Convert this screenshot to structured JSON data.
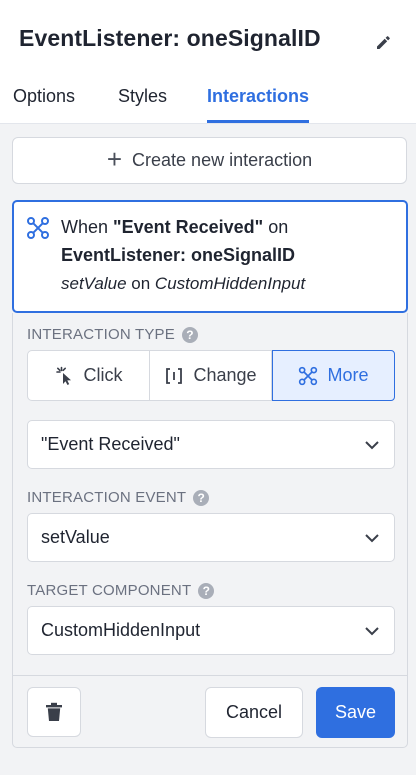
{
  "header": {
    "title": "EventListener: oneSignalID"
  },
  "tabs": [
    {
      "label": "Options"
    },
    {
      "label": "Styles"
    },
    {
      "label": "Interactions"
    }
  ],
  "create_button": {
    "label": "Create new interaction"
  },
  "interaction_card": {
    "when": "When",
    "event_name": "\"Event Received\"",
    "on1": "on",
    "component": "EventListener: oneSignalID",
    "action": "setValue",
    "on2": "on",
    "target": "CustomHiddenInput"
  },
  "form": {
    "interaction_type_label": "INTERACTION TYPE",
    "type_options": [
      {
        "label": "Click",
        "icon": "cursor-click-icon"
      },
      {
        "label": "Change",
        "icon": "brackets-icon"
      },
      {
        "label": "More",
        "icon": "nodes-icon"
      }
    ],
    "selected_type": "More",
    "event_select_value": "\"Event Received\"",
    "interaction_event_label": "INTERACTION EVENT",
    "interaction_event_value": "setValue",
    "target_component_label": "TARGET COMPONENT",
    "target_component_value": "CustomHiddenInput",
    "help_glyph": "?"
  },
  "footer": {
    "cancel_label": "Cancel",
    "save_label": "Save"
  },
  "colors": {
    "accent": "#2f6fe0",
    "panel_bg": "#f2f3f5",
    "border": "#d6d9df"
  }
}
